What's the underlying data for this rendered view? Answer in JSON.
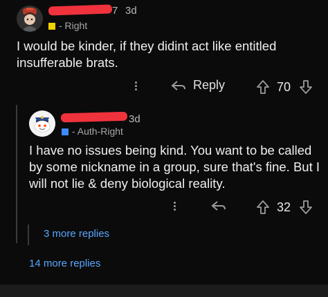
{
  "comment1": {
    "username_tail": "7",
    "time": "3d",
    "flair": "- Right",
    "flair_color": "#f2d200",
    "body": "I would be kinder, if they didint act like entitled insufferable brats.",
    "reply_label": "Reply",
    "score": "70"
  },
  "comment2": {
    "time": "3d",
    "flair": "- Auth-Right",
    "flair_color": "#3e8bff",
    "body": "I have no issues being kind. You want to be called by some nickname in a group, sure that's fine. But I will not lie & deny biological reality.",
    "score": "32"
  },
  "more_replies_nested": "3 more replies",
  "more_replies_top": "14 more replies",
  "icons": [
    "avatar-1",
    "avatar-2",
    "more-options-icon",
    "reply-icon",
    "upvote-icon",
    "downvote-icon"
  ]
}
